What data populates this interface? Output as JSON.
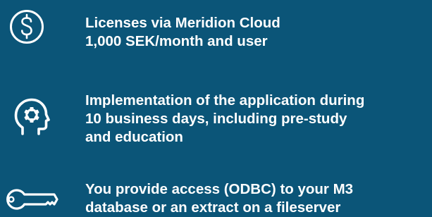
{
  "items": [
    {
      "icon": "dollar-coin-icon",
      "lines": [
        "Licenses via Meridion Cloud",
        "1,000 SEK/month and user"
      ]
    },
    {
      "icon": "head-gear-icon",
      "lines": [
        "Implementation of the application during",
        "10 business days, including pre-study",
        "and education"
      ]
    },
    {
      "icon": "key-icon",
      "lines": [
        "You provide access (ODBC) to your M3",
        "database or an extract on a fileserver"
      ]
    }
  ],
  "colors": {
    "background": "#0b5578",
    "foreground": "#ffffff"
  }
}
